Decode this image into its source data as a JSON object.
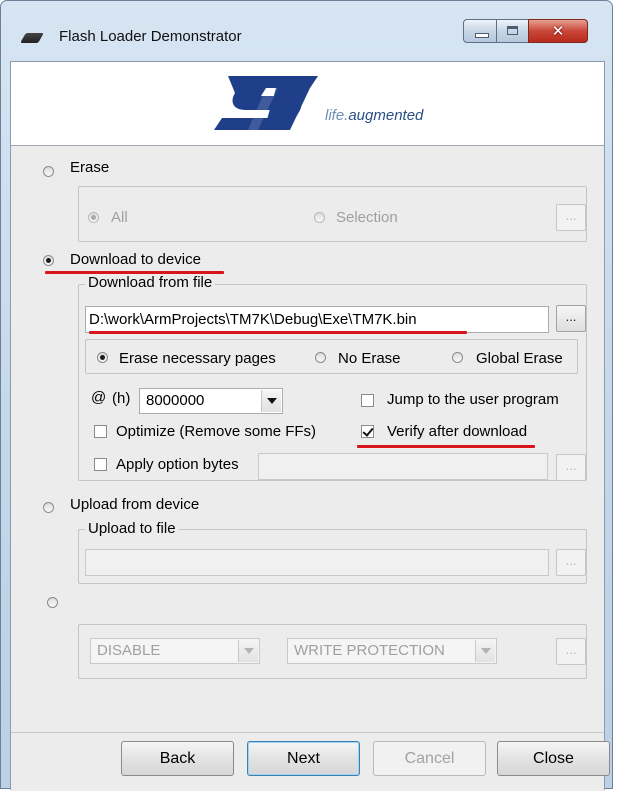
{
  "window": {
    "title": "Flash Loader Demonstrator",
    "controls": {
      "minimize": "minimize-icon",
      "maximize": "maximize-icon",
      "close": "close-icon"
    }
  },
  "banner": {
    "logo_text_1": "life.",
    "logo_text_2": "augmented"
  },
  "erase": {
    "label": "Erase",
    "selected": false,
    "all_label": "All",
    "selection_label": "Selection",
    "browse_label": "..."
  },
  "download": {
    "label": "Download to device",
    "selected": true,
    "group_title": "Download from file",
    "file_path": "D:\\work\\ArmProjects\\TM7K\\Debug\\Exe\\TM7K.bin",
    "browse_label": "...",
    "erase_options": [
      "Erase necessary pages",
      "No Erase",
      "Global Erase"
    ],
    "erase_selected": "Erase necessary pages",
    "address_at": "@",
    "address_h": "(h)",
    "address_value": "8000000",
    "jump_label": "Jump to the user program",
    "jump_checked": false,
    "optimize_label": "Optimize (Remove some FFs)",
    "optimize_checked": false,
    "verify_label": "Verify after download",
    "verify_checked": true,
    "option_bytes_label": "Apply option bytes",
    "option_bytes_checked": false,
    "option_bytes_value": "",
    "option_browse_label": "..."
  },
  "upload": {
    "label": "Upload from device",
    "selected": false,
    "group_title": "Upload to file",
    "file_path": "",
    "browse_label": "..."
  },
  "protection": {
    "selected": false,
    "mode_value": "DISABLE",
    "type_value": "WRITE PROTECTION",
    "browse_label": "..."
  },
  "buttons": {
    "back": "Back",
    "next": "Next",
    "cancel": "Cancel",
    "close": "Close"
  },
  "colors": {
    "annotation_underline": "#d8151b",
    "st_logo_blue": "#1f3f8a",
    "client_bg": "#ececec"
  }
}
